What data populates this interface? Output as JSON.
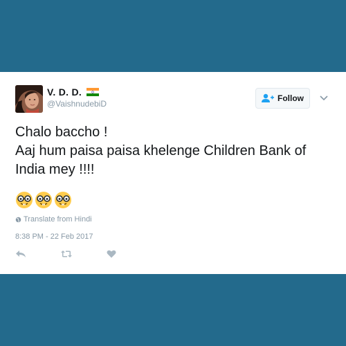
{
  "colors": {
    "background": "#236a8c",
    "card": "#ffffff",
    "text": "#14171a",
    "muted": "#8899a6",
    "accent": "#1da1f2"
  },
  "user": {
    "display_name": "V. D. D.",
    "handle": "@VaishnudebiD",
    "flag_icon": "india-flag-icon",
    "avatar_icon": "profile-avatar"
  },
  "follow_button": {
    "label": "Follow",
    "icon": "add-user-icon"
  },
  "menu": {
    "icon": "chevron-down-icon"
  },
  "tweet": {
    "lines": [
      "Chalo baccho !",
      "Aaj hum paisa paisa khelenge Children Bank of",
      "India mey !!!!"
    ],
    "emojis": [
      "nerd-face-emoji",
      "nerd-face-emoji",
      "nerd-face-emoji"
    ]
  },
  "translate": {
    "label": "Translate from Hindi",
    "icon": "globe-icon"
  },
  "timestamp": "8:38 PM - 22 Feb 2017",
  "actions": [
    "reply-icon",
    "retweet-icon",
    "like-icon"
  ]
}
